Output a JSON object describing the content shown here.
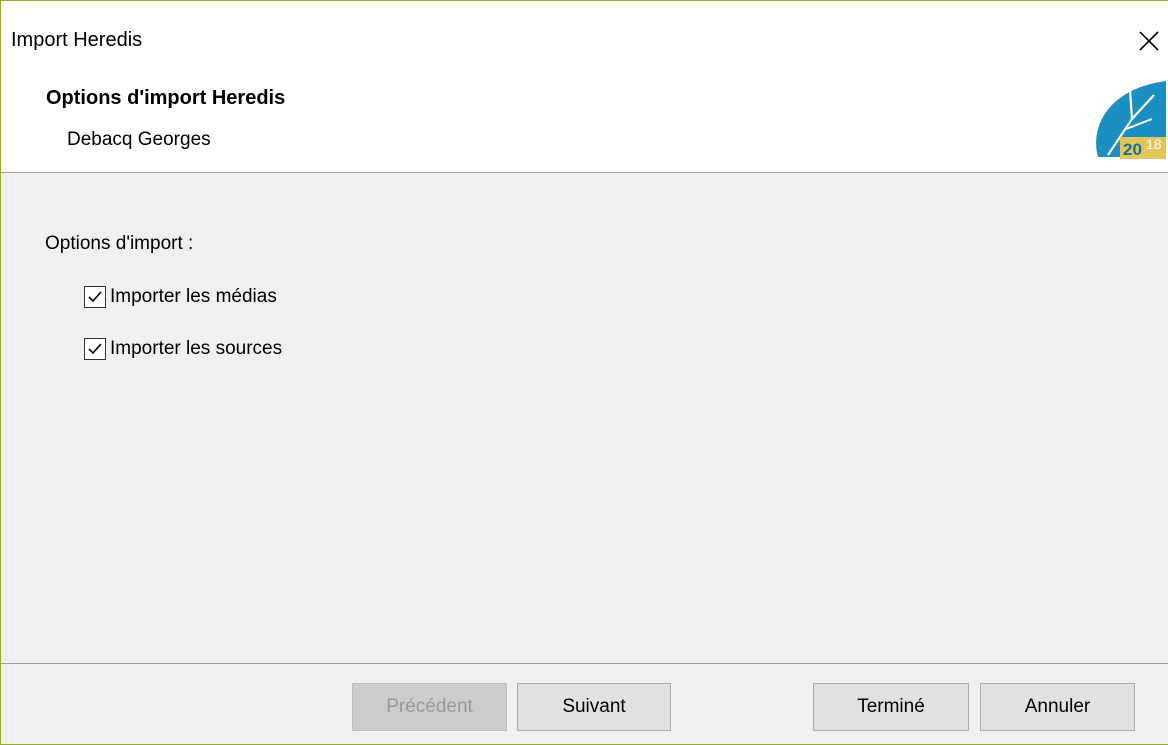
{
  "window": {
    "title": "Import Heredis",
    "close_icon": "close-icon"
  },
  "header": {
    "step_title": "Options d'import Heredis",
    "step_subtitle": "Debacq Georges",
    "logo": {
      "icon": "heredis-leaf-logo",
      "year_left": "20",
      "year_right": "18",
      "colors": {
        "leaf": "#1b8ec2",
        "badge": "#e2c65a"
      }
    }
  },
  "options": {
    "label": "Options d'import :",
    "items": [
      {
        "label": "Importer les médias",
        "checked": true
      },
      {
        "label": "Importer les sources",
        "checked": true
      }
    ]
  },
  "footer": {
    "buttons": {
      "previous": {
        "label": "Précédent",
        "enabled": false
      },
      "next": {
        "label": "Suivant",
        "enabled": true
      },
      "finish": {
        "label": "Terminé",
        "enabled": true
      },
      "cancel": {
        "label": "Annuler",
        "enabled": true
      }
    }
  }
}
